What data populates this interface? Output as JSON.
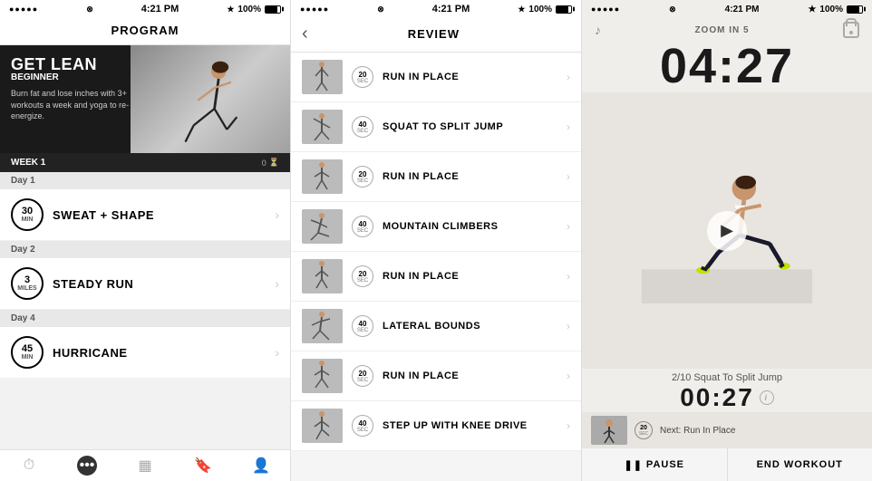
{
  "panel1": {
    "status": {
      "signal": "●●●●●",
      "wifi": "WiFi",
      "time": "4:21 PM",
      "bt": "BT",
      "battery_pct": "100%"
    },
    "header": "PROGRAM",
    "hero": {
      "title": "GET LEAN",
      "subtitle": "BEGINNER",
      "description": "Burn fat and lose inches with 3+ workouts a week and yoga to re-energize.",
      "week": "WEEK 1",
      "progress": "0"
    },
    "days": [
      {
        "day": "Day 1",
        "workouts": [
          {
            "number": "30",
            "unit": "MIN",
            "name": "SWEAT + SHAPE"
          }
        ]
      },
      {
        "day": "Day 2",
        "workouts": [
          {
            "number": "3",
            "unit": "MILES",
            "name": "STEADY RUN"
          }
        ]
      },
      {
        "day": "Day 4",
        "workouts": [
          {
            "number": "45",
            "unit": "MIN",
            "name": "HURRICANE"
          }
        ]
      }
    ],
    "nav": [
      "timer",
      "more",
      "grid",
      "bookmark",
      "person"
    ]
  },
  "panel2": {
    "status": {
      "signal": "●●●●●",
      "wifi": "WiFi",
      "time": "4:21 PM",
      "bt": "BT",
      "battery_pct": "100%"
    },
    "header": "REVIEW",
    "exercises": [
      {
        "sec": "20",
        "unit": "SEC",
        "name": "RUN IN PLACE"
      },
      {
        "sec": "40",
        "unit": "SEC",
        "name": "SQUAT TO SPLIT JUMP"
      },
      {
        "sec": "20",
        "unit": "SEC",
        "name": "RUN IN PLACE"
      },
      {
        "sec": "40",
        "unit": "SEC",
        "name": "MOUNTAIN CLIMBERS"
      },
      {
        "sec": "20",
        "unit": "SEC",
        "name": "RUN IN PLACE"
      },
      {
        "sec": "40",
        "unit": "SEC",
        "name": "LATERAL BOUNDS"
      },
      {
        "sec": "20",
        "unit": "SEC",
        "name": "RUN IN PLACE"
      },
      {
        "sec": "40",
        "unit": "SEC",
        "name": "STEP UP WITH KNEE DRIVE"
      }
    ]
  },
  "panel3": {
    "status": {
      "signal": "●●●●●",
      "wifi": "WiFi",
      "time": "4:21 PM",
      "bt": "BT",
      "battery_pct": "100%"
    },
    "zoom_label": "ZOOM IN 5",
    "big_timer": "04:27",
    "exercise_name": "2/10 Squat To Split Jump",
    "small_timer": "00:27",
    "next_sec": "20",
    "next_unit": "SEC",
    "next_label": "Next: Run In Place",
    "pause_label": "❚❚ PAUSE",
    "end_label": "END WORKOUT"
  }
}
